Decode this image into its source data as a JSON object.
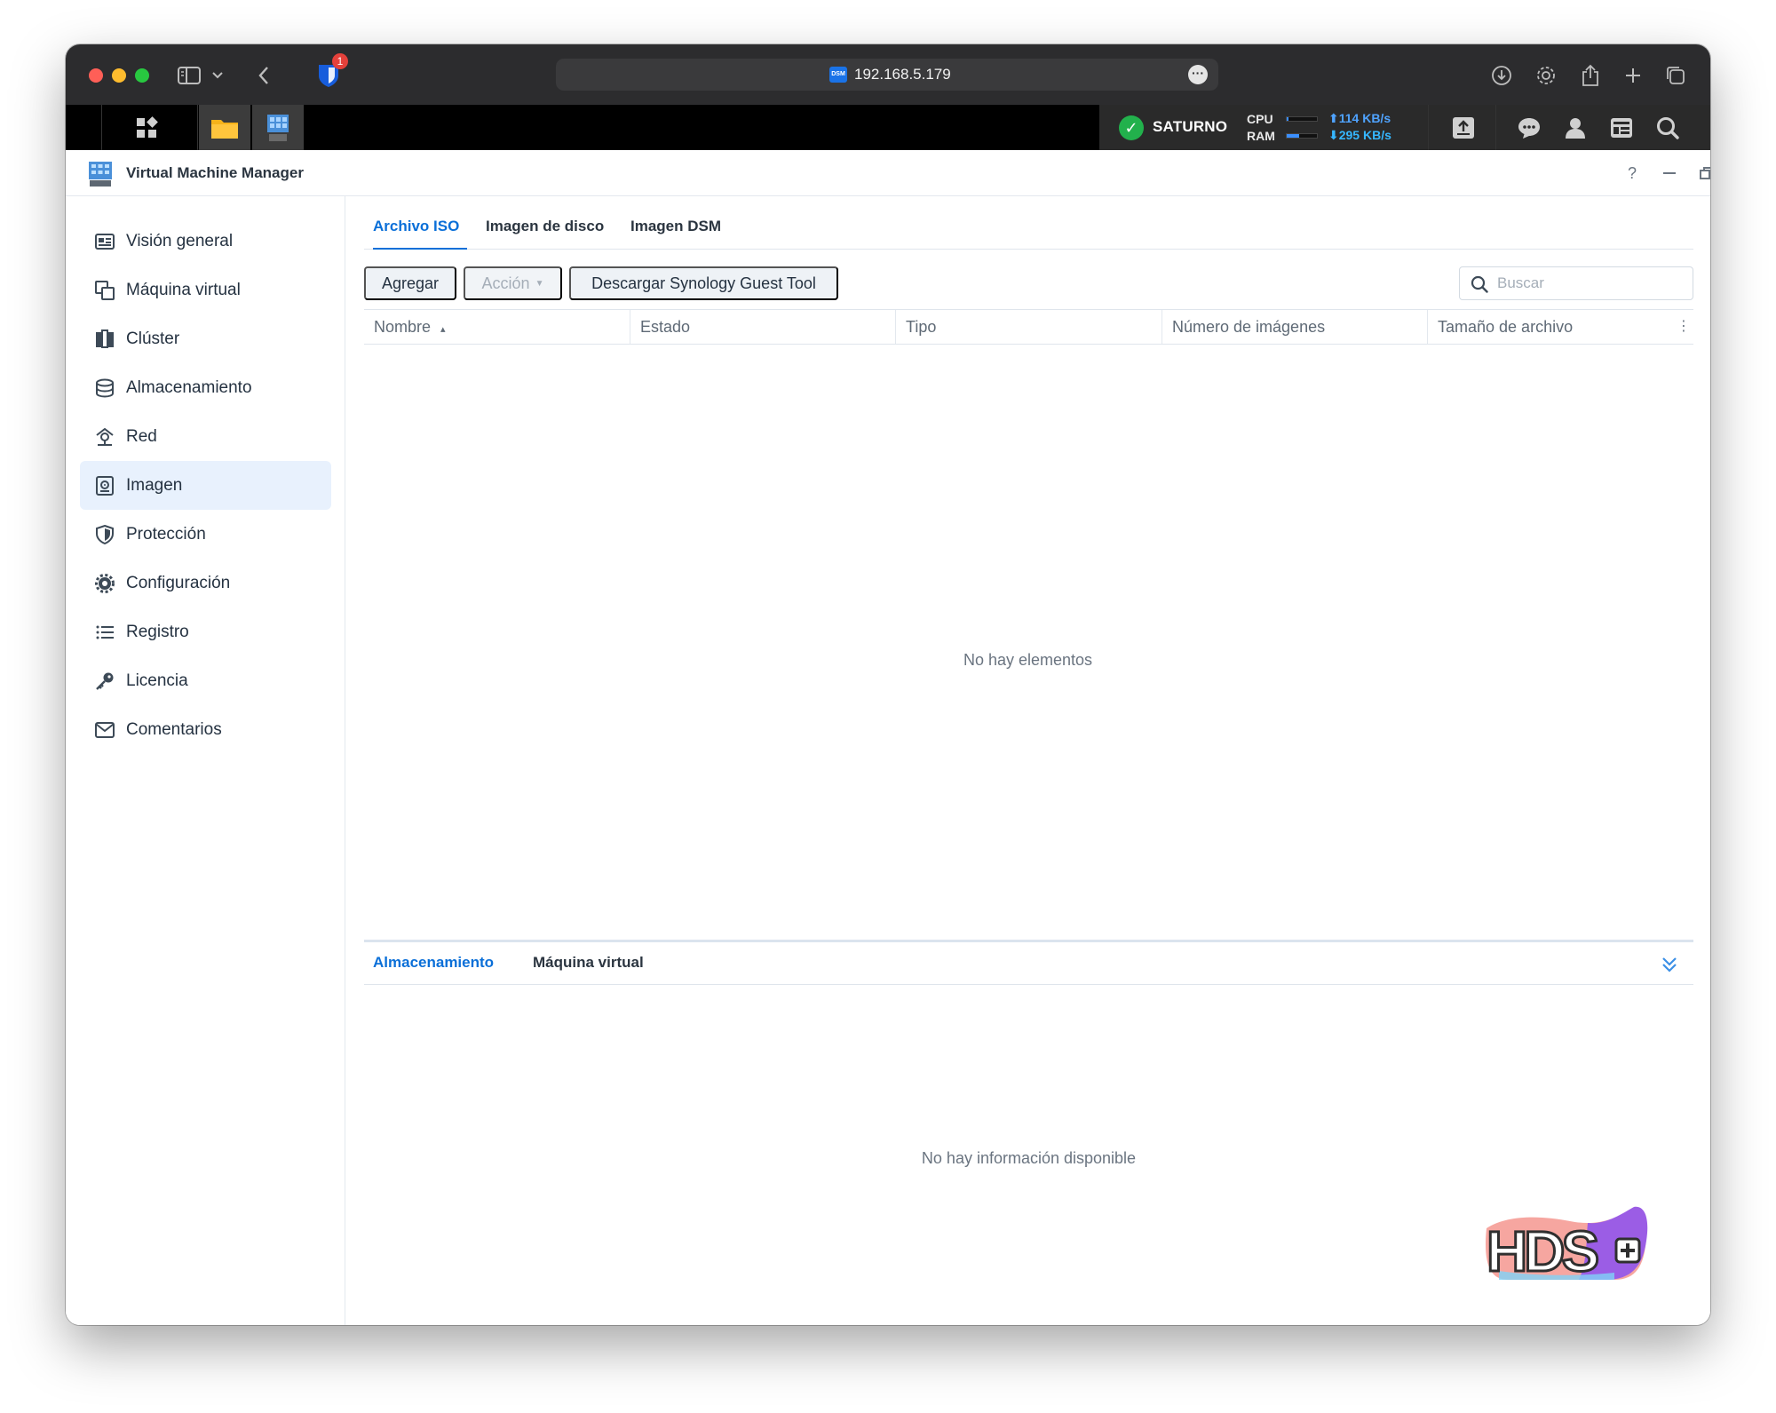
{
  "browser": {
    "url": "192.168.5.179",
    "favicon_text": "DSM",
    "extension_badge_count": "1"
  },
  "taskbar": {
    "server_name": "SATURNO",
    "cpu_label": "CPU",
    "ram_label": "RAM",
    "cpu_level": 0.05,
    "ram_level": 0.4,
    "upload_speed": "114 KB/s",
    "download_speed": "295 KB/s",
    "status_color": "#22b14c"
  },
  "app": {
    "title": "Virtual Machine Manager",
    "help_label": "?",
    "accent_color": "#0a6fd8"
  },
  "sidebar": {
    "items": [
      {
        "label": "Visión general",
        "icon": "overview-icon"
      },
      {
        "label": "Máquina virtual",
        "icon": "virtual-machine-icon"
      },
      {
        "label": "Clúster",
        "icon": "cluster-icon"
      },
      {
        "label": "Almacenamiento",
        "icon": "storage-icon"
      },
      {
        "label": "Red",
        "icon": "network-icon"
      },
      {
        "label": "Imagen",
        "icon": "image-icon"
      },
      {
        "label": "Protección",
        "icon": "shield-icon"
      },
      {
        "label": "Configuración",
        "icon": "gear-icon"
      },
      {
        "label": "Registro",
        "icon": "list-icon"
      },
      {
        "label": "Licencia",
        "icon": "key-icon"
      },
      {
        "label": "Comentarios",
        "icon": "mail-icon"
      }
    ],
    "active_index": 5
  },
  "main": {
    "tabs": [
      "Archivo ISO",
      "Imagen de disco",
      "Imagen DSM"
    ],
    "active_tab": 0,
    "toolbar": {
      "add_label": "Agregar",
      "action_label": "Acción",
      "download_label": "Descargar Synology Guest Tool",
      "search_placeholder": "Buscar"
    },
    "columns": [
      "Nombre",
      "Estado",
      "Tipo",
      "Número de imágenes",
      "Tamaño de archivo"
    ],
    "sort_indicator": "▴",
    "empty_message": "No hay elementos"
  },
  "detail": {
    "tabs": [
      "Almacenamiento",
      "Máquina virtual"
    ],
    "active_tab": 0,
    "empty_message": "No hay información disponible"
  },
  "watermark": {
    "text": "HDS+"
  }
}
